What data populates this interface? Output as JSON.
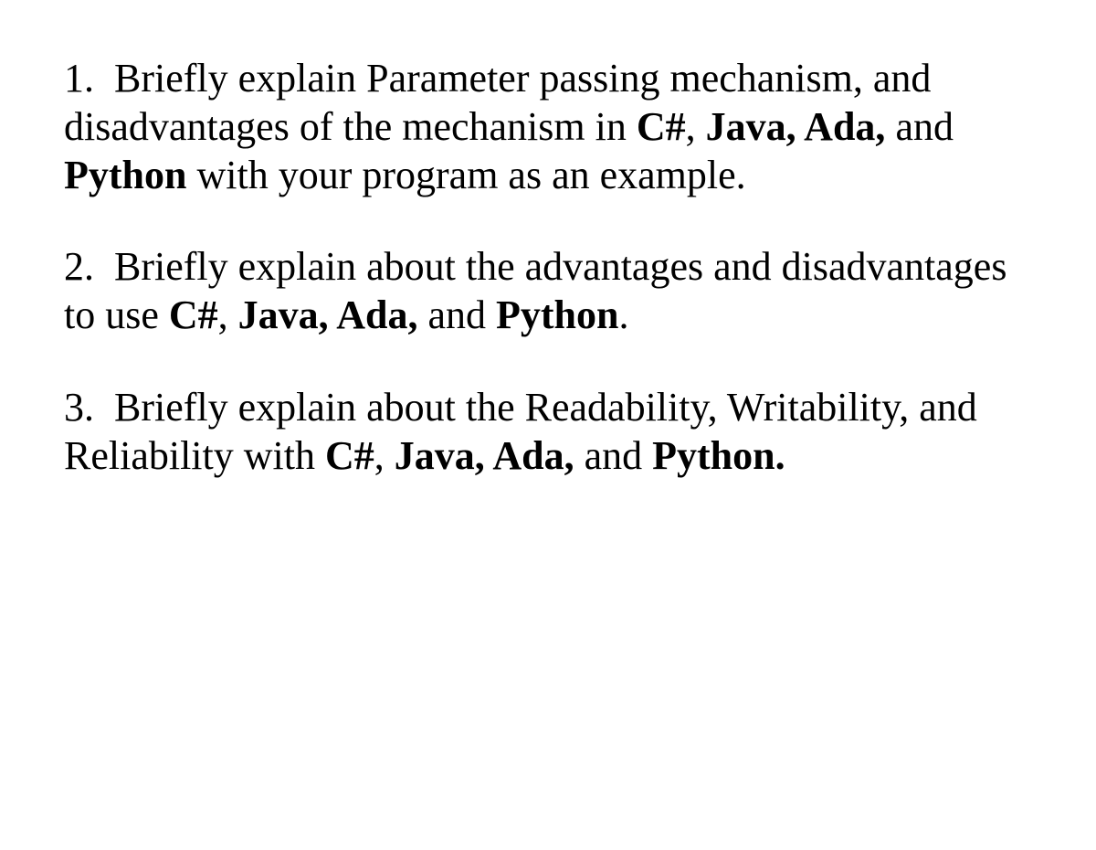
{
  "questions": [
    {
      "number": "1.",
      "text_before": "Briefly explain Parameter passing mechanism, and disadvantages of the mechanism in ",
      "bold1": "C#",
      "mid1": ", ",
      "bold2": "Java, Ada,",
      "mid2": " and ",
      "bold3": "Python",
      "text_after": " with your program as an example."
    },
    {
      "number": "2.",
      "text_before": "Briefly explain about the advantages and disadvantages to use ",
      "bold1": "C#",
      "mid1": ", ",
      "bold2": "Java, Ada,",
      "mid2": " and ",
      "bold3": "Python",
      "text_after": "."
    },
    {
      "number": "3.",
      "text_before": "Briefly explain about the Readability, Writability, and Reliability with ",
      "bold1": "C#",
      "mid1": ", ",
      "bold2": "Java, Ada,",
      "mid2": " and ",
      "bold3": "Python.",
      "text_after": ""
    }
  ]
}
